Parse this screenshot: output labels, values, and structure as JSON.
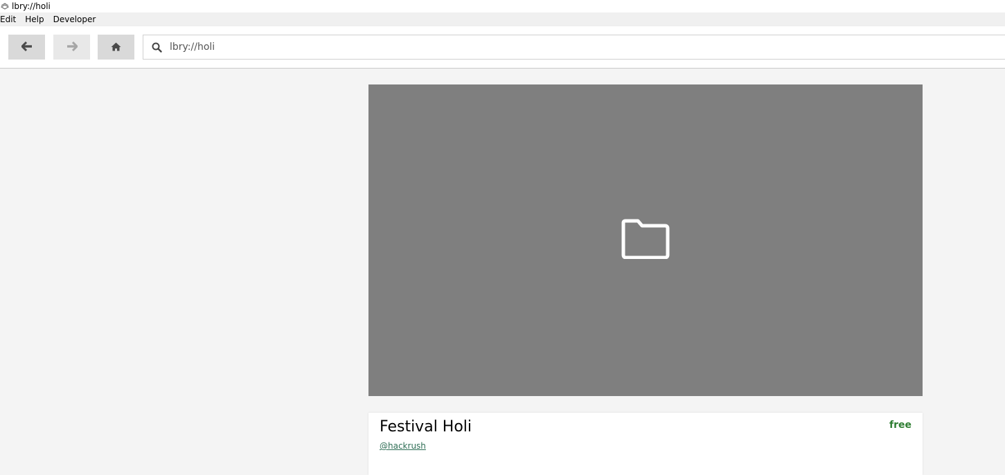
{
  "window": {
    "title": "lbry://holi"
  },
  "menu": {
    "items": [
      "Edit",
      "Help",
      "Developer"
    ]
  },
  "toolbar": {
    "back_icon": "arrow-left-icon",
    "forward_icon": "arrow-right-icon",
    "home_icon": "home-icon",
    "search_value": "lbry://holi"
  },
  "media": {
    "placeholder_icon": "folder-icon",
    "background": "#7f7f7f"
  },
  "card": {
    "title": "Festival Holi",
    "price": "free",
    "channel": "@hackrush"
  },
  "colors": {
    "price": "#2e7d32",
    "channel_link": "#2e6e55"
  }
}
